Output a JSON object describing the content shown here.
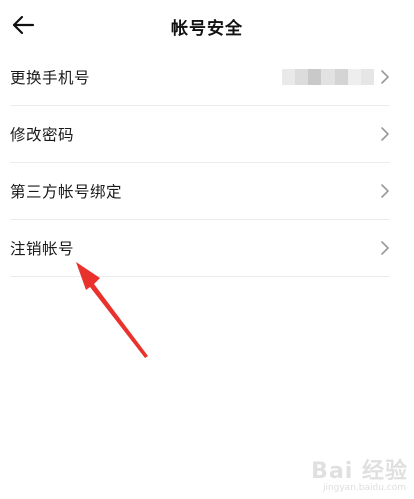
{
  "header": {
    "title": "帐号安全",
    "back_icon": "arrow-left-icon"
  },
  "menu": {
    "items": [
      {
        "label": "更换手机号",
        "value_redacted": true
      },
      {
        "label": "修改密码"
      },
      {
        "label": "第三方帐号绑定"
      },
      {
        "label": "注销帐号"
      }
    ]
  },
  "annotation": {
    "arrow_color": "#e8322b"
  },
  "watermark": {
    "brand": "Bai 经验",
    "url": "jingyan.baidu.com"
  },
  "colors": {
    "divider": "#ececec",
    "chevron": "#9a9a9a",
    "text": "#1a1a1a",
    "background": "#ffffff"
  }
}
